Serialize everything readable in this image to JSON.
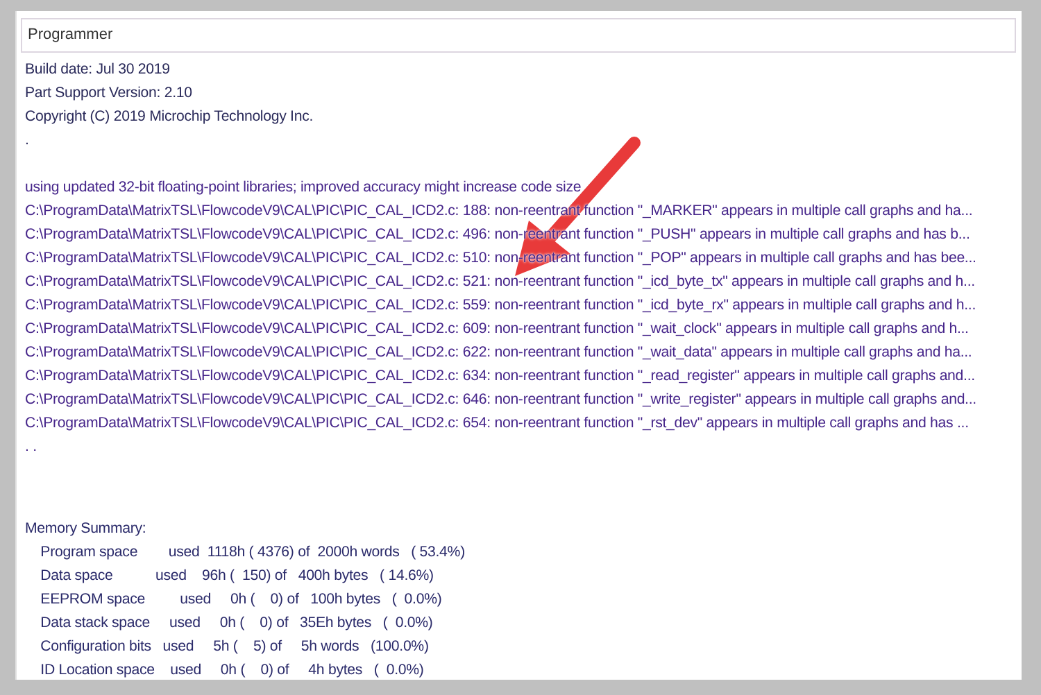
{
  "panel": {
    "title": "Programmer"
  },
  "sections": [
    {
      "kind": "info",
      "lines": [
        "Build date: Jul 30 2019",
        "Part Support Version: 2.10",
        "Copyright (C) 2019 Microchip Technology Inc.",
        "."
      ]
    },
    {
      "kind": "warnings",
      "lines": [
        "using updated 32-bit floating-point libraries; improved accuracy might increase code size",
        "C:\\ProgramData\\MatrixTSL\\FlowcodeV9\\CAL\\PIC\\PIC_CAL_ICD2.c: 188: non-reentrant function \"_MARKER\" appears in multiple call graphs and ha...",
        "C:\\ProgramData\\MatrixTSL\\FlowcodeV9\\CAL\\PIC\\PIC_CAL_ICD2.c: 496: non-reentrant function \"_PUSH\" appears in multiple call graphs and has b...",
        "C:\\ProgramData\\MatrixTSL\\FlowcodeV9\\CAL\\PIC\\PIC_CAL_ICD2.c: 510: non-reentrant function \"_POP\" appears in multiple call graphs and has bee...",
        "C:\\ProgramData\\MatrixTSL\\FlowcodeV9\\CAL\\PIC\\PIC_CAL_ICD2.c: 521: non-reentrant function \"_icd_byte_tx\" appears in multiple call graphs and h...",
        "C:\\ProgramData\\MatrixTSL\\FlowcodeV9\\CAL\\PIC\\PIC_CAL_ICD2.c: 559: non-reentrant function \"_icd_byte_rx\" appears in multiple call graphs and h...",
        "C:\\ProgramData\\MatrixTSL\\FlowcodeV9\\CAL\\PIC\\PIC_CAL_ICD2.c: 609: non-reentrant function \"_wait_clock\" appears in multiple call graphs and h...",
        "C:\\ProgramData\\MatrixTSL\\FlowcodeV9\\CAL\\PIC\\PIC_CAL_ICD2.c: 622: non-reentrant function \"_wait_data\" appears in multiple call graphs and ha...",
        "C:\\ProgramData\\MatrixTSL\\FlowcodeV9\\CAL\\PIC\\PIC_CAL_ICD2.c: 634: non-reentrant function \"_read_register\" appears in multiple call graphs and...",
        "C:\\ProgramData\\MatrixTSL\\FlowcodeV9\\CAL\\PIC\\PIC_CAL_ICD2.c: 646: non-reentrant function \"_write_register\" appears in multiple call graphs and...",
        "C:\\ProgramData\\MatrixTSL\\FlowcodeV9\\CAL\\PIC\\PIC_CAL_ICD2.c: 654: non-reentrant function \"_rst_dev\" appears in multiple call graphs and has ...",
        ". ."
      ]
    },
    {
      "kind": "memory",
      "lines": [
        "Memory Summary:",
        "    Program space        used  1118h ( 4376) of  2000h words   ( 53.4%)",
        "    Data space           used    96h (  150) of   400h bytes   ( 14.6%)",
        "    EEPROM space         used     0h (    0) of   100h bytes   (  0.0%)",
        "    Data stack space     used     0h (    0) of   35Eh bytes   (  0.0%)",
        "    Configuration bits   used     5h (    5) of     5h words   (100.0%)",
        "    ID Location space    used     0h (    0) of     4h bytes   (  0.0%)"
      ]
    }
  ]
}
